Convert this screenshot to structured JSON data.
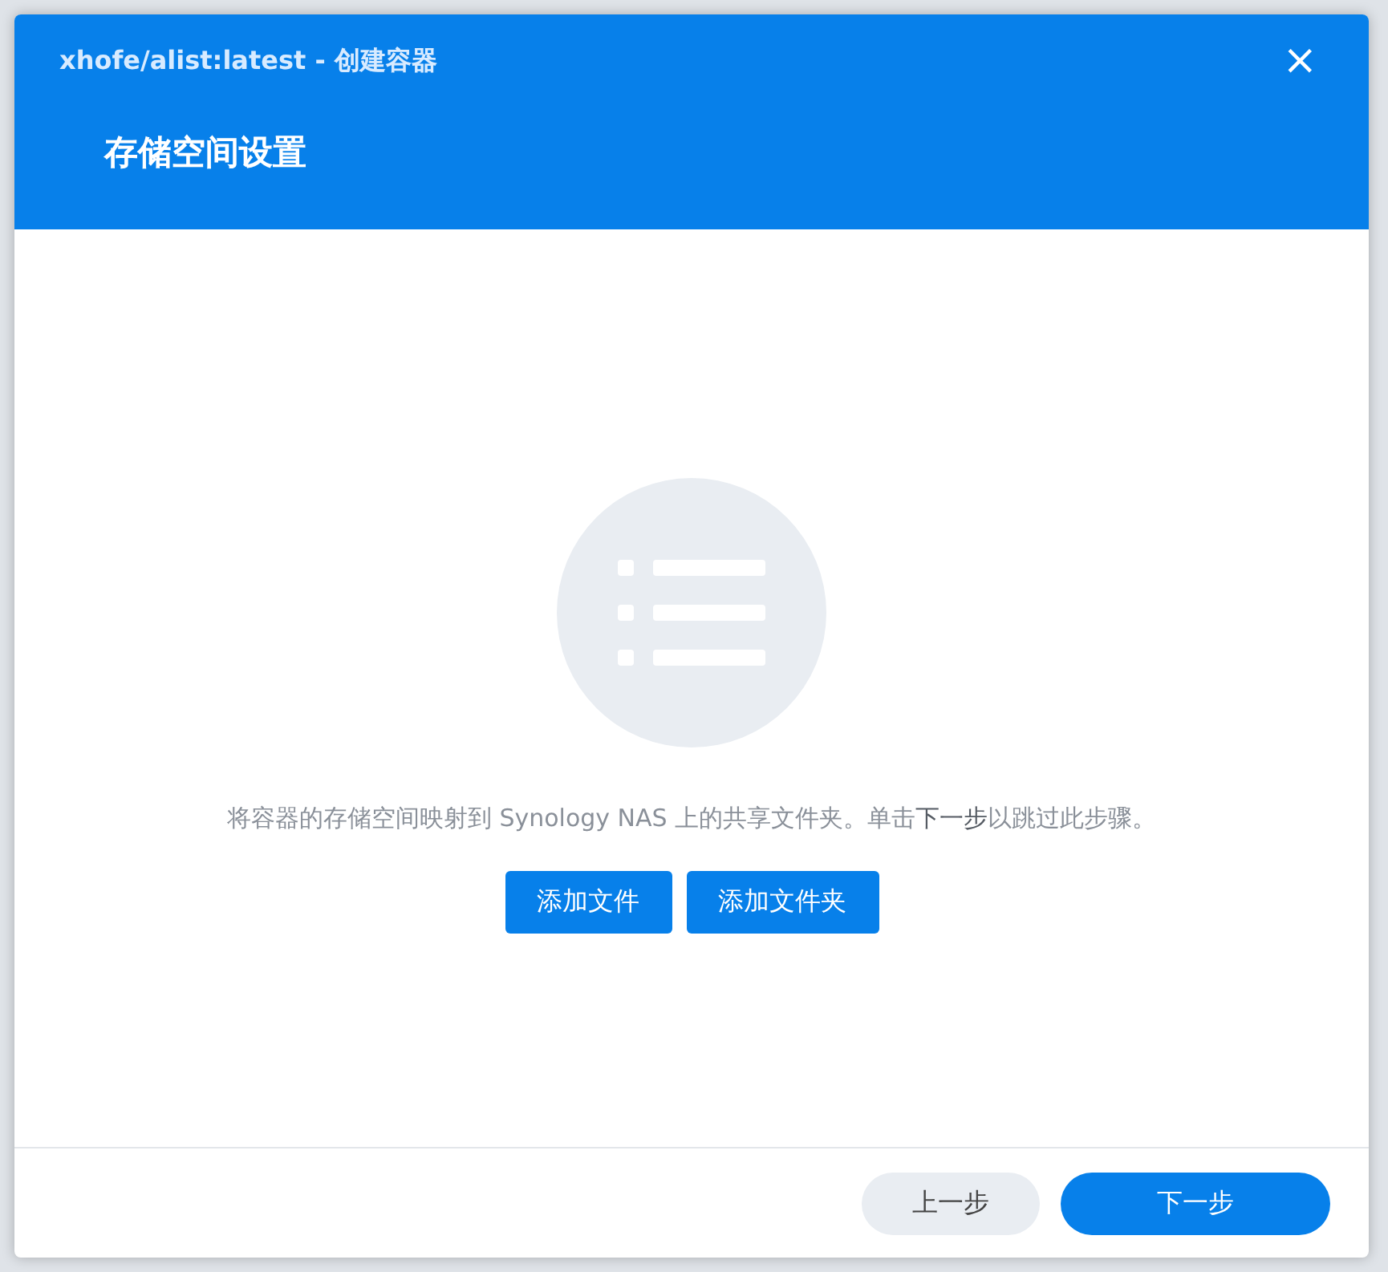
{
  "window": {
    "title": "xhofe/alist:latest - 创建容器",
    "close": "×"
  },
  "header": {
    "heading": "存储空间设置"
  },
  "body": {
    "description": "将容器的存储空间映射到 Synology NAS 上的共享文件夹。单击**下一步**以跳过此步骤。",
    "buttons": [
      "添加文件",
      "添加文件夹"
    ]
  },
  "footer": {
    "buttons": [
      {
        "label": "上一步",
        "kind": "secondary"
      },
      {
        "label": "下一步",
        "kind": "primary"
      }
    ]
  }
}
